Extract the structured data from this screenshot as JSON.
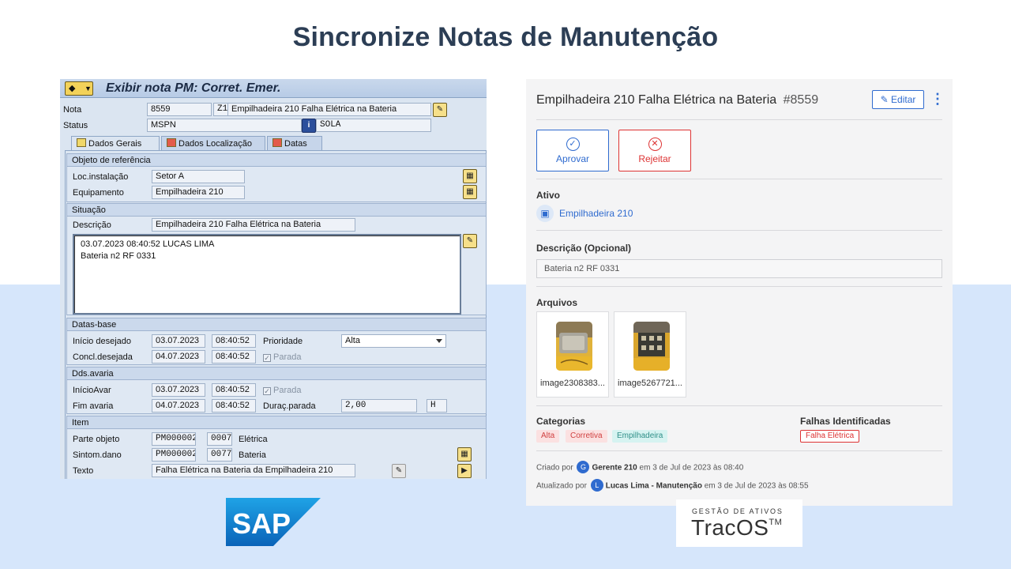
{
  "title": "Sincronize Notas de Manutenção",
  "sap": {
    "window_title": "Exibir nota PM: Corret. Emer.",
    "nota_label": "Nota",
    "nota_value": "8559",
    "nota_type": "Z1",
    "nota_desc": "Empilhadeira 210 Falha Elétrica na Bateria",
    "status_label": "Status",
    "status_value": "MSPN",
    "status_user": "SOLA",
    "tabs": [
      {
        "label": "Dados Gerais"
      },
      {
        "label": "Dados Localização"
      },
      {
        "label": "Datas"
      }
    ],
    "objeto_title": "Objeto de referência",
    "loc_label": "Loc.instalação",
    "loc_value": "Setor A",
    "equip_label": "Equipamento",
    "equip_value": "Empilhadeira 210",
    "situacao_title": "Situação",
    "descricao_label": "Descrição",
    "descricao_value": "Empilhadeira 210 Falha Elétrica na Bateria",
    "long_text_line1": "03.07.2023 08:40:52 LUCAS LIMA",
    "long_text_line2": "Bateria n2 RF 0331",
    "datas_title": "Datas-base",
    "inicio_label": "Início desejado",
    "inicio_date": "03.07.2023",
    "inicio_time": "08:40:52",
    "prioridade_label": "Prioridade",
    "prioridade_value": "Alta",
    "concl_label": "Concl.desejada",
    "concl_date": "04.07.2023",
    "concl_time": "08:40:52",
    "parada_label": "Parada",
    "avaria_title": "Dds.avaria",
    "inicioavar_label": "InícioAvar",
    "inicioavar_date": "03.07.2023",
    "inicioavar_time": "08:40:52",
    "parada2_label": "Parada",
    "fim_label": "Fim avaria",
    "fim_date": "04.07.2023",
    "fim_time": "08:40:52",
    "durac_label": "Duraç.parada",
    "durac_value": "2,00",
    "durac_unit": "H",
    "item_title": "Item",
    "parte_label": "Parte objeto",
    "parte_code": "PM000002",
    "parte_num": "0007",
    "parte_text": "Elétrica",
    "sintom_label": "Sintom.dano",
    "sintom_code": "PM000002",
    "sintom_num": "0077",
    "sintom_text": "Bateria",
    "texto_label": "Texto",
    "texto_value": "Falha Elétrica na Bateria da Empilhadeira 210"
  },
  "tracos": {
    "title": "Empilhadeira 210 Falha Elétrica na Bateria",
    "number": "#8559",
    "edit_label": "Editar",
    "approve_label": "Aprovar",
    "reject_label": "Rejeitar",
    "ativo_label": "Ativo",
    "ativo_value": "Empilhadeira 210",
    "descricao_label": "Descrição (Opcional)",
    "descricao_value": "Bateria n2 RF 0331",
    "arquivos_label": "Arquivos",
    "files": [
      {
        "name": "image2308383..."
      },
      {
        "name": "image5267721..."
      }
    ],
    "categorias_label": "Categorias",
    "categorias": [
      "Alta",
      "Corretiva",
      "Empilhadeira"
    ],
    "falhas_label": "Falhas Identificadas",
    "falhas": [
      "Falha Elétrica"
    ],
    "criado_prefix": "Criado por",
    "criado_avatar": "G",
    "criado_user": "Gerente 210",
    "criado_suffix": "em 3 de Jul de 2023 às 08:40",
    "atualizado_prefix": "Atualizado por",
    "atualizado_avatar": "L",
    "atualizado_user": "Lucas Lima - Manutenção",
    "atualizado_suffix": "em 3 de Jul de 2023 às 08:55"
  },
  "logos": {
    "sap_text": "SAP",
    "tracos_sub": "GESTÃO DE ATIVOS",
    "tracos_main": "TracOS",
    "tracos_tm": "TM"
  },
  "colors": {
    "title": "#2c3e55",
    "band": "#d6e6fb",
    "accent_blue": "#2f6bcf",
    "reject_red": "#dd3333",
    "sap_blue": "#1b74bd"
  }
}
